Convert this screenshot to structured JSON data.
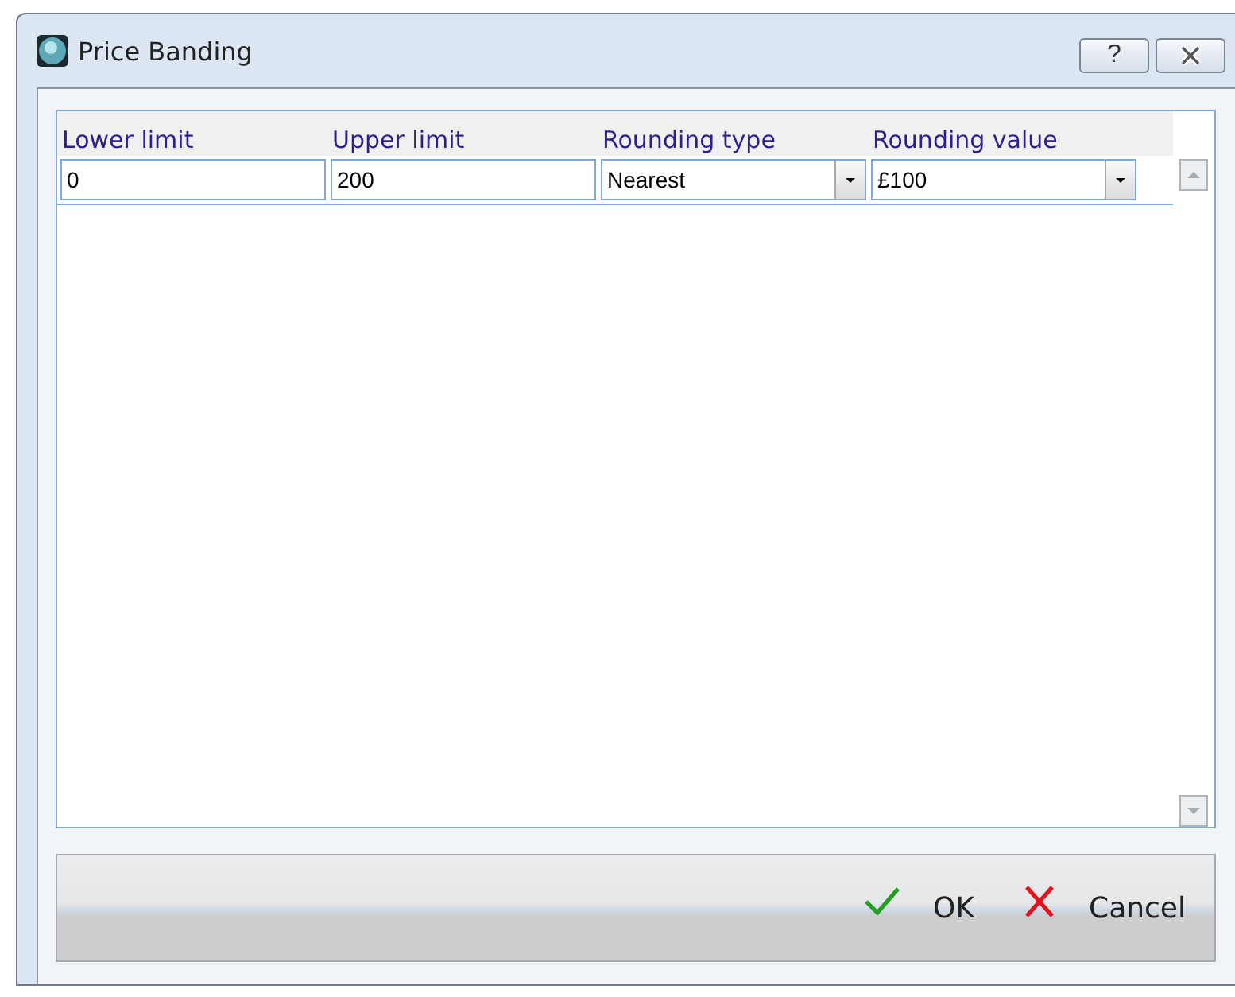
{
  "window": {
    "title": "Price Banding",
    "help_button": "?"
  },
  "table": {
    "columns": [
      "Lower limit",
      "Upper limit",
      "Rounding type",
      "Rounding value"
    ],
    "rows": [
      {
        "cells": [
          {
            "kind": "text",
            "value": "0"
          },
          {
            "kind": "text",
            "value": "200"
          },
          {
            "kind": "dropdown",
            "value": "Nearest"
          },
          {
            "kind": "dropdown",
            "value": "£100"
          }
        ]
      }
    ]
  },
  "buttons": [
    {
      "kind": "ok",
      "label": "OK"
    },
    {
      "kind": "cancel",
      "label": "Cancel"
    }
  ]
}
